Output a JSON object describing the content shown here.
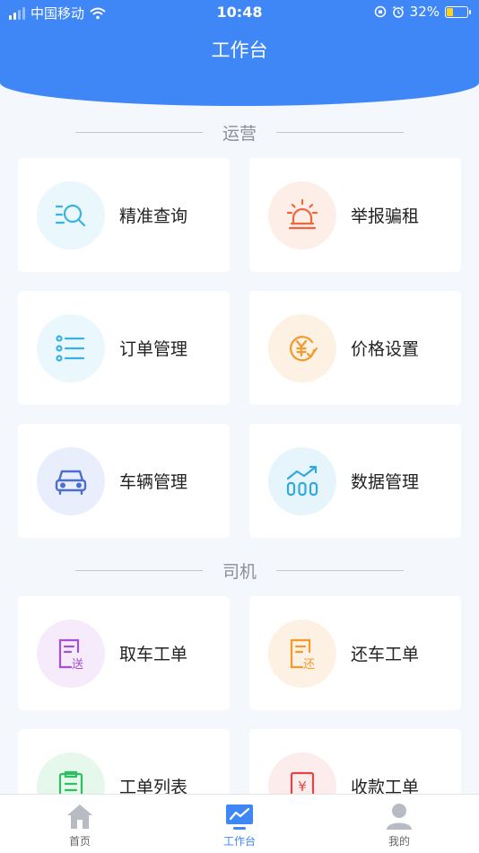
{
  "status_bar": {
    "carrier": "中国移动",
    "time": "10:48",
    "battery": "32%",
    "battery_level": 0.32
  },
  "header": {
    "title": "工作台"
  },
  "sections": [
    {
      "title": "运营",
      "items": [
        {
          "label": "精准查询",
          "icon": "search-list-icon"
        },
        {
          "label": "举报骗租",
          "icon": "alarm-icon"
        },
        {
          "label": "订单管理",
          "icon": "list-icon"
        },
        {
          "label": "价格设置",
          "icon": "yuan-price-icon"
        },
        {
          "label": "车辆管理",
          "icon": "car-icon"
        },
        {
          "label": "数据管理",
          "icon": "chart-icon"
        }
      ]
    },
    {
      "title": "司机",
      "items": [
        {
          "label": "取车工单",
          "icon": "pickup-doc-icon",
          "badge": "送"
        },
        {
          "label": "还车工单",
          "icon": "return-doc-icon",
          "badge": "还"
        },
        {
          "label": "工单列表",
          "icon": "clipboard-icon"
        },
        {
          "label": "收款工单",
          "icon": "receipt-icon",
          "badge": "¥"
        }
      ]
    }
  ],
  "tabbar": [
    {
      "label": "首页",
      "icon": "home-icon"
    },
    {
      "label": "工作台",
      "icon": "workbench-icon",
      "active": true
    },
    {
      "label": "我的",
      "icon": "profile-icon"
    }
  ],
  "colors": {
    "primary": "#3f86f7",
    "background": "#f4f7fc"
  }
}
